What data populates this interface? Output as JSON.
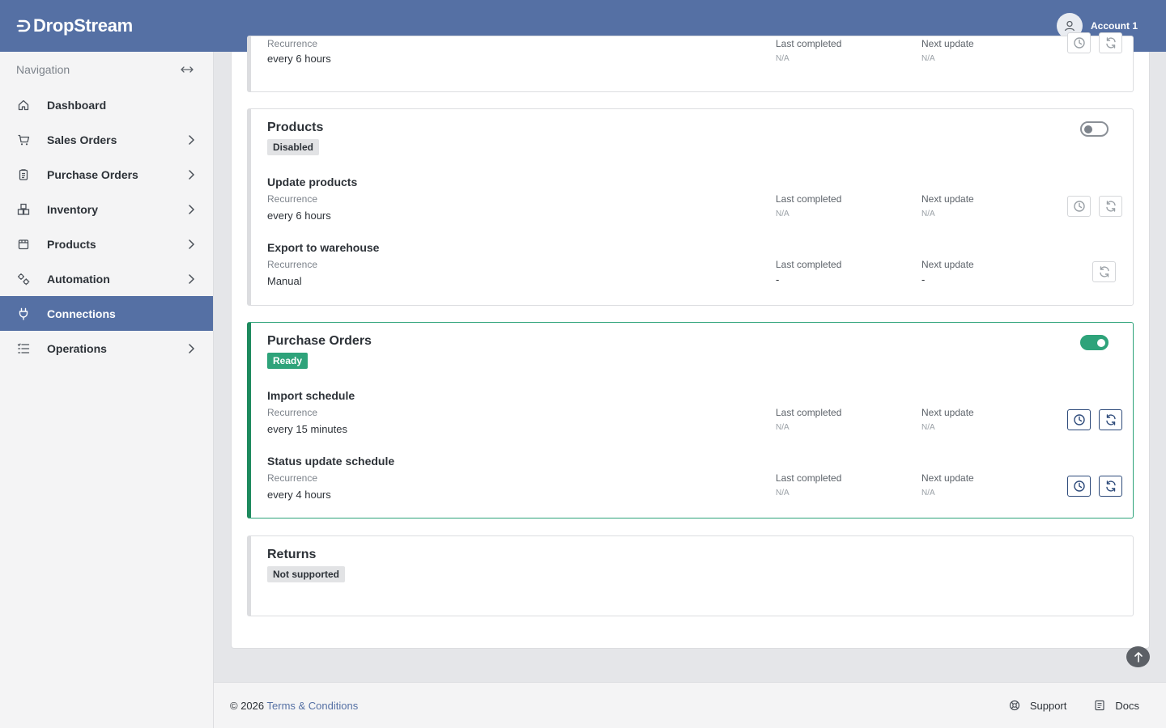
{
  "app": {
    "name": "DropStream"
  },
  "account": {
    "name": "Account 1"
  },
  "sidebar": {
    "header": "Navigation",
    "items": [
      {
        "label": "Dashboard",
        "icon": "home-icon",
        "chevron": false,
        "active": false
      },
      {
        "label": "Sales Orders",
        "icon": "cart-icon",
        "chevron": true,
        "active": false
      },
      {
        "label": "Purchase Orders",
        "icon": "clipboard-icon",
        "chevron": true,
        "active": false
      },
      {
        "label": "Inventory",
        "icon": "boxes-icon",
        "chevron": true,
        "active": false
      },
      {
        "label": "Products",
        "icon": "package-icon",
        "chevron": true,
        "active": false
      },
      {
        "label": "Automation",
        "icon": "gears-icon",
        "chevron": true,
        "active": false
      },
      {
        "label": "Connections",
        "icon": "plug-icon",
        "chevron": false,
        "active": true
      },
      {
        "label": "Operations",
        "icon": "list-icon",
        "chevron": true,
        "active": false
      }
    ]
  },
  "labels": {
    "recurrence": "Recurrence",
    "last_completed": "Last completed",
    "next_update": "Next update"
  },
  "cards": {
    "top": {
      "rows": [
        {
          "recurrence": "every 6 hours",
          "last_completed": "N/A",
          "next_update": "N/A"
        }
      ]
    },
    "products": {
      "title": "Products",
      "badge": "Disabled",
      "toggle_on": false,
      "rows": [
        {
          "name": "Update products",
          "recurrence": "every 6 hours",
          "last_completed": "N/A",
          "next_update": "N/A"
        },
        {
          "name": "Export to warehouse",
          "recurrence": "Manual",
          "last_completed": "-",
          "next_update": "-"
        }
      ]
    },
    "purchase_orders": {
      "title": "Purchase Orders",
      "badge": "Ready",
      "toggle_on": true,
      "rows": [
        {
          "name": "Import schedule",
          "recurrence": "every 15 minutes",
          "last_completed": "N/A",
          "next_update": "N/A"
        },
        {
          "name": "Status update schedule",
          "recurrence": "every 4 hours",
          "last_completed": "N/A",
          "next_update": "N/A"
        }
      ]
    },
    "returns": {
      "title": "Returns",
      "badge": "Not supported"
    }
  },
  "footer": {
    "copyright": "© 2026",
    "terms": "Terms & Conditions",
    "support": "Support",
    "docs": "Docs"
  },
  "colors": {
    "brand": "#5570a4",
    "ready": "#2ea37a",
    "disabled_badge": "#e2e3e5"
  }
}
